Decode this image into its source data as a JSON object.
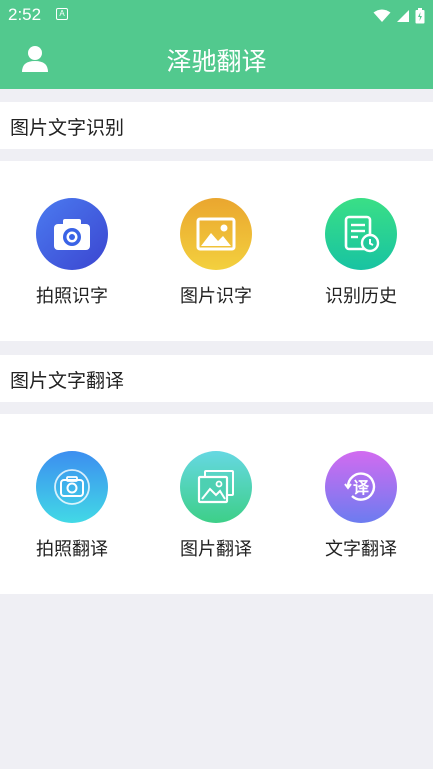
{
  "status": {
    "time": "2:52",
    "notif": "A"
  },
  "header": {
    "title": "泽驰翻译"
  },
  "sections": [
    {
      "title": "图片文字识别",
      "items": [
        {
          "label": "拍照识字",
          "icon": "camera-icon",
          "color1": "#3a63e6",
          "color2": "#4a4fd8"
        },
        {
          "label": "图片识字",
          "icon": "image-icon",
          "color1": "#f1c33a",
          "color2": "#ea9e2f"
        },
        {
          "label": "识别历史",
          "icon": "history-icon",
          "color1": "#36db8a",
          "color2": "#1fc69a"
        }
      ]
    },
    {
      "title": "图片文字翻译",
      "items": [
        {
          "label": "拍照翻译",
          "icon": "camera-translate-icon",
          "color1": "#3fd1e8",
          "color2": "#3c8ef0"
        },
        {
          "label": "图片翻译",
          "icon": "image-translate-icon",
          "color1": "#5fd6e0",
          "color2": "#3fcf8e"
        },
        {
          "label": "文字翻译",
          "icon": "text-translate-icon",
          "color1": "#d06cf0",
          "color2": "#6b7af0"
        }
      ]
    }
  ]
}
